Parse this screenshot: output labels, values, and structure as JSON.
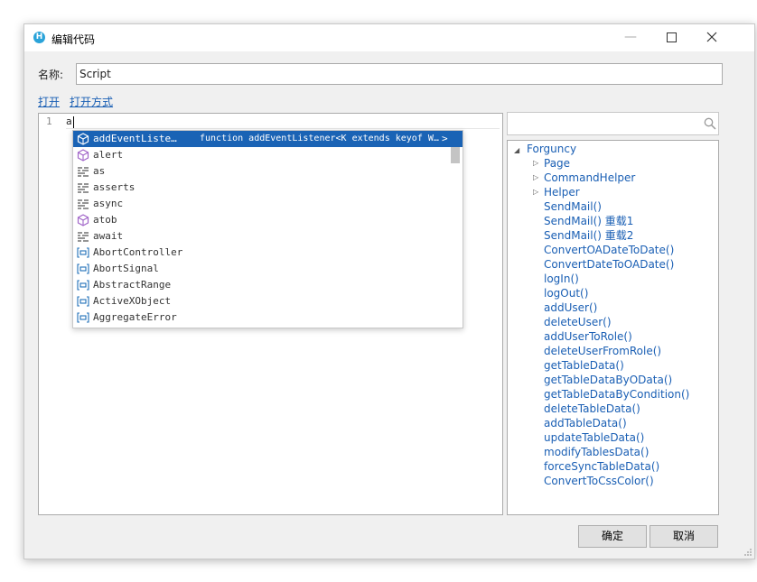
{
  "window": {
    "title": "编辑代码",
    "app_icon_letter": "H"
  },
  "name_field": {
    "label": "名称:",
    "value": "Script"
  },
  "links": {
    "open": "打开",
    "open_with": "打开方式"
  },
  "editor": {
    "line_number": "1",
    "code": "a"
  },
  "suggestions": {
    "selected_detail": "function addEventListener<K extends keyof W…",
    "items": [
      {
        "label": "addEventListe…",
        "kind": "method"
      },
      {
        "label": "alert",
        "kind": "method"
      },
      {
        "label": "as",
        "kind": "keyword"
      },
      {
        "label": "asserts",
        "kind": "keyword"
      },
      {
        "label": "async",
        "kind": "keyword"
      },
      {
        "label": "atob",
        "kind": "method"
      },
      {
        "label": "await",
        "kind": "keyword"
      },
      {
        "label": "AbortController",
        "kind": "variable"
      },
      {
        "label": "AbortSignal",
        "kind": "variable"
      },
      {
        "label": "AbstractRange",
        "kind": "variable"
      },
      {
        "label": "ActiveXObject",
        "kind": "variable"
      },
      {
        "label": "AggregateError",
        "kind": "variable"
      }
    ]
  },
  "search": {
    "placeholder": ""
  },
  "tree": {
    "root": "Forguncy",
    "groups": [
      "Page",
      "CommandHelper",
      "Helper"
    ],
    "items": [
      "SendMail()",
      "SendMail() 重载1",
      "SendMail() 重载2",
      "ConvertOADateToDate()",
      "ConvertDateToOADate()",
      "logIn()",
      "logOut()",
      "addUser()",
      "deleteUser()",
      "addUserToRole()",
      "deleteUserFromRole()",
      "getTableData()",
      "getTableDataByOData()",
      "getTableDataByCondition()",
      "deleteTableData()",
      "addTableData()",
      "updateTableData()",
      "modifyTablesData()",
      "forceSyncTableData()",
      "ConvertToCssColor()"
    ]
  },
  "buttons": {
    "ok": "确定",
    "cancel": "取消"
  },
  "colors": {
    "selection": "#1a63b5",
    "link": "#1a5fb4",
    "method_icon": "#a064c8",
    "variable_icon": "#1f6fb8"
  }
}
